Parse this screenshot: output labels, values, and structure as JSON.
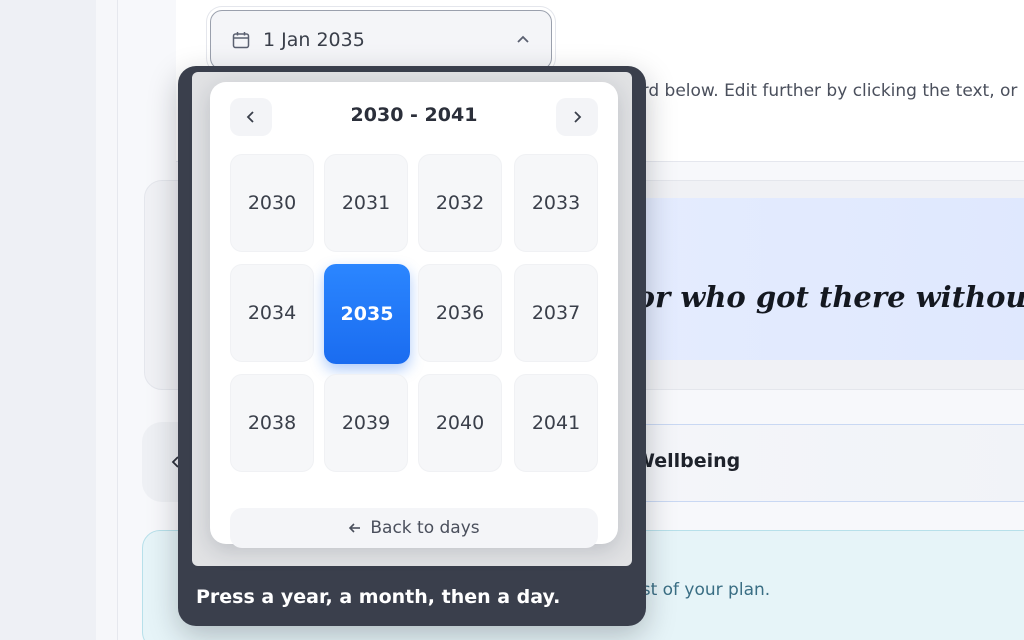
{
  "date_field": {
    "value": "1 Jan 2035"
  },
  "hint": {
    "text": "Fill in the goal, and we put together the goal card below. Edit further by clicking the text, or build from pieces."
  },
  "goal": {
    "title": "Director who got there without"
  },
  "category": {
    "label": "al Wellbeing"
  },
  "tip": {
    "text": "Save it. Goal set. So then it breaks down into the rest of your plan."
  },
  "overlay": {
    "caption": "Press a year, a month, then a day."
  },
  "picker": {
    "range_title": "2030 - 2041",
    "years": [
      {
        "label": "2030",
        "selected": false
      },
      {
        "label": "2031",
        "selected": false
      },
      {
        "label": "2032",
        "selected": false
      },
      {
        "label": "2033",
        "selected": false
      },
      {
        "label": "2034",
        "selected": false
      },
      {
        "label": "2035",
        "selected": true
      },
      {
        "label": "2036",
        "selected": false
      },
      {
        "label": "2037",
        "selected": false
      },
      {
        "label": "2038",
        "selected": false
      },
      {
        "label": "2039",
        "selected": false
      },
      {
        "label": "2040",
        "selected": false
      },
      {
        "label": "2041",
        "selected": false
      }
    ],
    "back_label": "Back to days"
  },
  "colors": {
    "accent": "#1a6cf0",
    "overlay": "#3a3f4c"
  }
}
